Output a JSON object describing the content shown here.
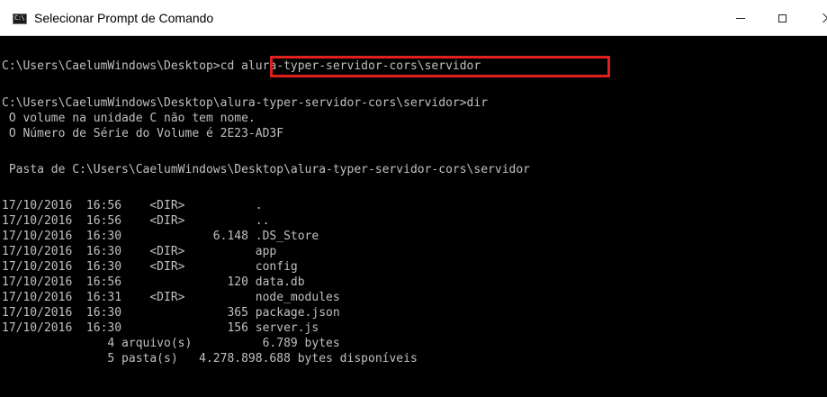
{
  "window": {
    "title": "Selecionar Prompt de Comando",
    "icon_label": "C:\\"
  },
  "controls": {
    "minimize_icon": "minimize-icon",
    "maximize_icon": "maximize-icon",
    "close_icon": "close-icon"
  },
  "highlight_color": "#e0201b",
  "console": {
    "lines": [
      "C:\\Users\\CaelumWindows\\Desktop>cd alura-typer-servidor-cors\\servidor",
      "",
      "C:\\Users\\CaelumWindows\\Desktop\\alura-typer-servidor-cors\\servidor>dir",
      " O volume na unidade C não tem nome.",
      " O Número de Série do Volume é 2E23-AD3F",
      "",
      " Pasta de C:\\Users\\CaelumWindows\\Desktop\\alura-typer-servidor-cors\\servidor",
      "",
      "17/10/2016  16:56    <DIR>          .",
      "17/10/2016  16:56    <DIR>          ..",
      "17/10/2016  16:30             6.148 .DS_Store",
      "17/10/2016  16:30    <DIR>          app",
      "17/10/2016  16:30    <DIR>          config",
      "17/10/2016  16:56               120 data.db",
      "17/10/2016  16:31    <DIR>          node_modules",
      "17/10/2016  16:30               365 package.json",
      "17/10/2016  16:30               156 server.js",
      "               4 arquivo(s)          6.789 bytes",
      "               5 pasta(s)   4.278.898.688 bytes disponíveis"
    ]
  }
}
